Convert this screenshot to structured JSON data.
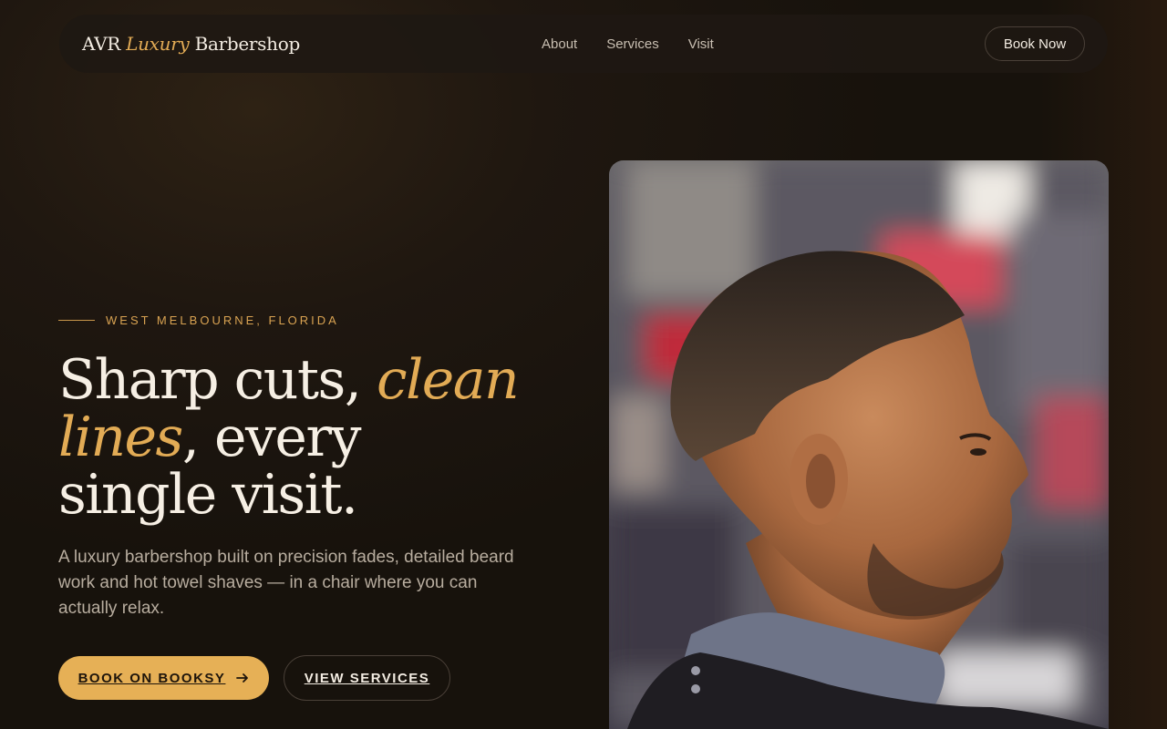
{
  "nav": {
    "logo_prefix": "AVR",
    "logo_accent": "Luxury",
    "logo_suffix": "Barbershop",
    "links": [
      "About",
      "Services",
      "Visit"
    ],
    "cta": "Book Now"
  },
  "hero": {
    "eyebrow": "WEST MELBOURNE, FLORIDA",
    "headline_part1": "Sharp cuts, ",
    "headline_accent": "clean lines",
    "headline_part2": ", every single visit.",
    "subtext": "A luxury barbershop built on precision fades, detailed beard work and hot towel shaves — in a chair where you can actually relax.",
    "primary_button": "BOOK ON BOOKSY",
    "primary_icon": "arrow-right-icon",
    "secondary_button": "VIEW SERVICES",
    "image_icon": "barber-client-photo"
  },
  "colors": {
    "accent": "#e6b056",
    "background": "#1f1710",
    "text": "#f3ece2"
  }
}
